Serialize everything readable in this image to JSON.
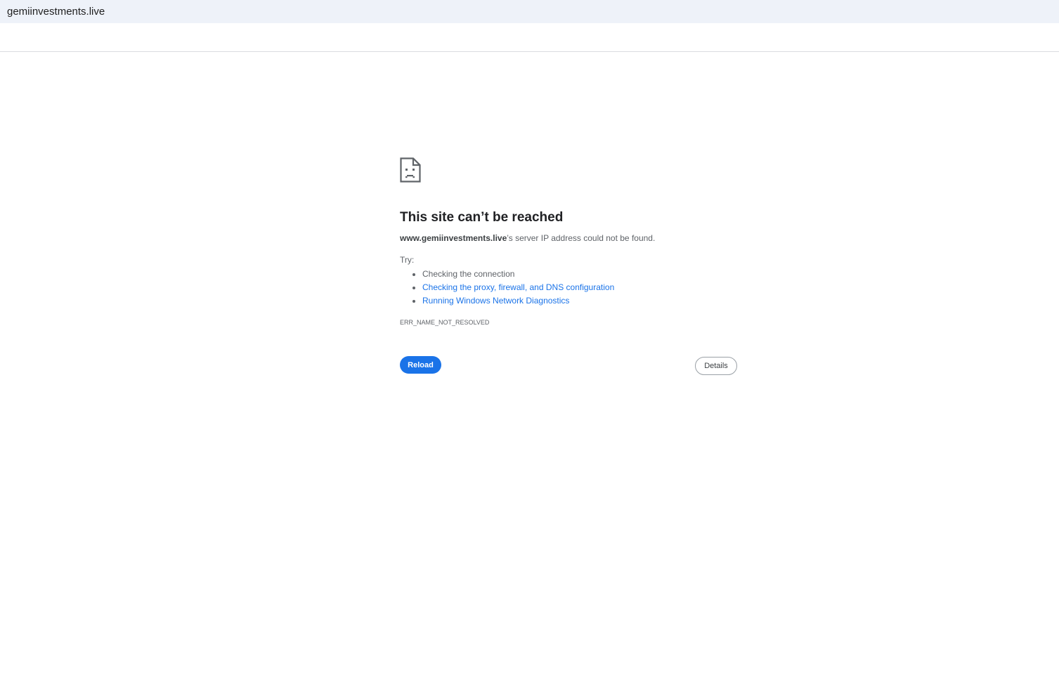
{
  "address_bar": {
    "url": "gemiinvestments.live"
  },
  "error_page": {
    "icon": "sad-page-icon",
    "title": "This site can’t be reached",
    "host": "www.gemiinvestments.live",
    "description_suffix": "’s server IP address could not be found.",
    "try_label": "Try:",
    "suggestions": [
      "Checking the connection",
      "Checking the proxy, firewall, and DNS configuration",
      "Running Windows Network Diagnostics"
    ],
    "error_code": "ERR_NAME_NOT_RESOLVED",
    "reload_label": "Reload",
    "details_label": "Details"
  },
  "colors": {
    "accent": "#1a73e8",
    "address_bar_bg": "#eef2f9"
  }
}
